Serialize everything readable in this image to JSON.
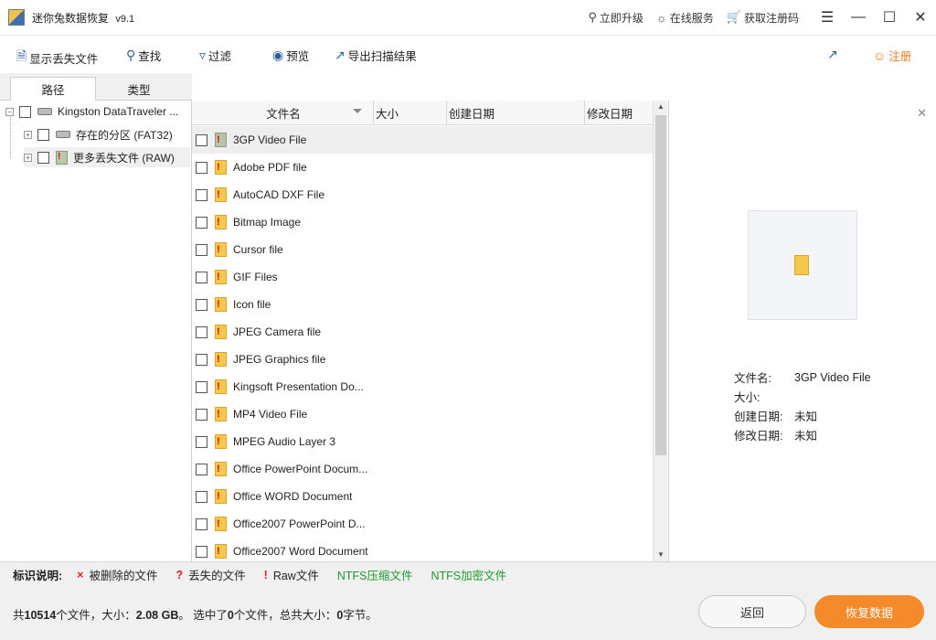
{
  "app": {
    "title": "迷你兔数据恢复",
    "version": "v9.1"
  },
  "titlebar": {
    "upgrade": "立即升级",
    "online_service": "在线服务",
    "get_code": "获取注册码"
  },
  "toolbar": {
    "show_lost": "显示丢失文件",
    "find": "查找",
    "filter": "过滤",
    "preview": "预览",
    "export": "导出扫描结果",
    "register": "注册"
  },
  "tabs": {
    "path": "路径",
    "type": "类型"
  },
  "tree": {
    "root": "Kingston DataTraveler ...",
    "children": [
      {
        "label": "存在的分区 (FAT32)"
      },
      {
        "label": "更多丢失文件 (RAW)"
      }
    ]
  },
  "list": {
    "columns": {
      "name": "文件名",
      "size": "大小",
      "created": "创建日期",
      "modified": "修改日期"
    },
    "rows": [
      "3GP Video File",
      "Adobe PDF file",
      "AutoCAD DXF File",
      "Bitmap Image",
      "Cursor file",
      "GIF Files",
      "Icon file",
      "JPEG Camera file",
      "JPEG Graphics file",
      "Kingsoft Presentation Do...",
      "MP4 Video File",
      "MPEG Audio Layer 3",
      "Office PowerPoint Docum...",
      "Office WORD Document",
      "Office2007 PowerPoint D...",
      "Office2007 Word Document"
    ]
  },
  "preview": {
    "filename_label": "文件名:",
    "filename_value": "3GP Video File",
    "size_label": "大小:",
    "size_value": "",
    "created_label": "创建日期:",
    "created_value": "未知",
    "modified_label": "修改日期:",
    "modified_value": "未知"
  },
  "legend": {
    "title": "标识说明:",
    "deleted": "被删除的文件",
    "lost": "丢失的文件",
    "raw": "Raw文件",
    "ntfs_compressed": "NTFS压缩文件",
    "ntfs_encrypted": "NTFS加密文件",
    "colors": {
      "deleted": "#e02020",
      "lost": "#e02020",
      "raw": "#e02020",
      "ntfs": "#1a9a2a"
    }
  },
  "status": {
    "prefix": "共",
    "count": "10514",
    "mid1": "个文件，大小：",
    "size": "2.08 GB",
    "mid2": "。 选中了",
    "selected": "0",
    "mid3": "个文件，总共大小：",
    "bytes": "0",
    "suffix": "字节。"
  },
  "buttons": {
    "back": "返回",
    "recover": "恢复数据"
  }
}
